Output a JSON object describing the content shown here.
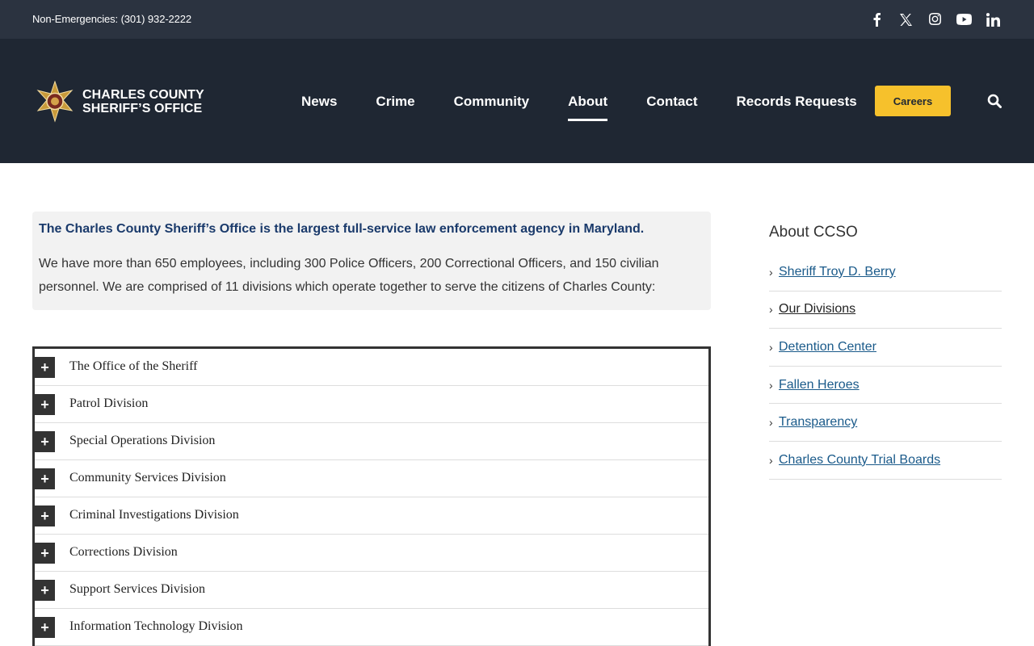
{
  "topbar": {
    "phone": "Non-Emergencies: (301) 932-2222",
    "social": [
      "facebook-icon",
      "x-icon",
      "instagram-icon",
      "youtube-icon",
      "linkedin-icon"
    ]
  },
  "header": {
    "logo_line1": "CHARLES COUNTY",
    "logo_line2": "SHERIFF’S OFFICE",
    "nav": [
      {
        "label": "News"
      },
      {
        "label": "Crime"
      },
      {
        "label": "Community"
      },
      {
        "label": "About"
      },
      {
        "label": "Contact"
      },
      {
        "label": "Records Requests"
      }
    ],
    "active_nav": "About",
    "careers_label": "Careers"
  },
  "intro": {
    "lead": "The Charles County Sheriff’s Office is the largest full-service law enforcement agency in Maryland.",
    "body": "We have more than 650 employees, including 300 Police Officers, 200 Correctional Officers, and 150 civilian personnel. We are comprised of 11 divisions which operate together to serve the citizens of Charles County:"
  },
  "accordion": {
    "toggle_symbol": "+",
    "items": [
      {
        "title": "The Office of the Sheriff"
      },
      {
        "title": "Patrol Division"
      },
      {
        "title": "Special Operations Division"
      },
      {
        "title": "Community Services Division"
      },
      {
        "title": "Criminal Investigations Division"
      },
      {
        "title": "Corrections Division"
      },
      {
        "title": "Support Services Division"
      },
      {
        "title": "Information Technology Division"
      }
    ]
  },
  "sidebar": {
    "title": "About CCSO",
    "items": [
      {
        "label": "Sheriff Troy D. Berry"
      },
      {
        "label": "Our Divisions"
      },
      {
        "label": "Detention Center"
      },
      {
        "label": "Fallen Heroes"
      },
      {
        "label": "Transparency"
      },
      {
        "label": "Charles County Trial Boards"
      }
    ],
    "current": "Our Divisions"
  },
  "colors": {
    "topbar_bg": "#2b3340",
    "header_bg": "#1f2733",
    "careers_bg": "#f6c12c",
    "lead_text": "#1a3a6b",
    "link": "#1a5a8a"
  }
}
